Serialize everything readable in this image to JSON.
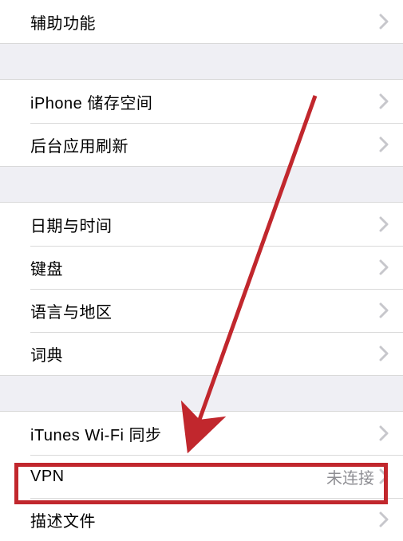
{
  "groups": [
    {
      "rows": [
        {
          "label": "辅助功能",
          "value": ""
        }
      ]
    },
    {
      "rows": [
        {
          "label": "iPhone 储存空间",
          "value": ""
        },
        {
          "label": "后台应用刷新",
          "value": ""
        }
      ]
    },
    {
      "rows": [
        {
          "label": "日期与时间",
          "value": ""
        },
        {
          "label": "键盘",
          "value": ""
        },
        {
          "label": "语言与地区",
          "value": ""
        },
        {
          "label": "词典",
          "value": ""
        }
      ]
    },
    {
      "rows": [
        {
          "label": "iTunes Wi-Fi 同步",
          "value": ""
        },
        {
          "label": "VPN",
          "value": "未连接"
        },
        {
          "label": "描述文件",
          "value": ""
        }
      ]
    }
  ]
}
